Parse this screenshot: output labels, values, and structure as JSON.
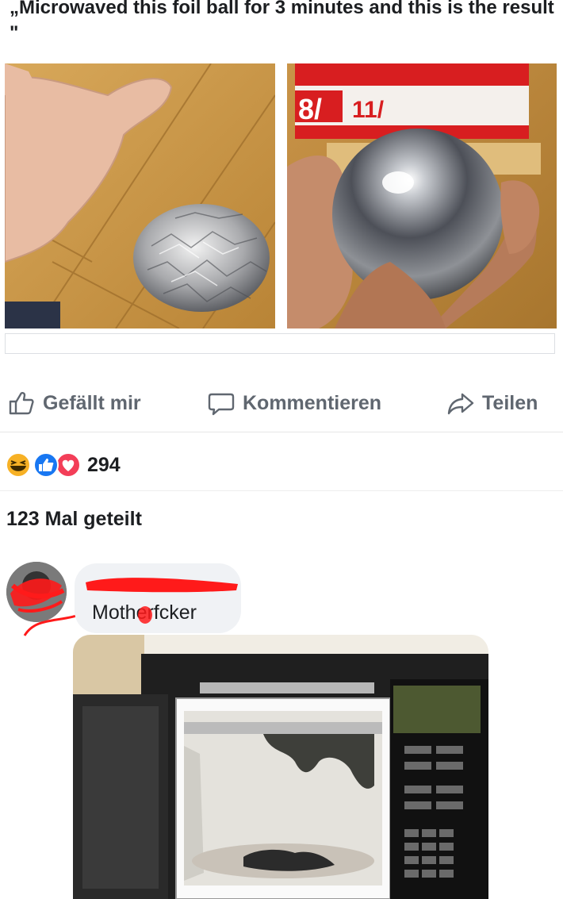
{
  "post": {
    "caption": "„Microwaved this foil ball for 3 minutes and this is the result \""
  },
  "actions": {
    "like_label": "Gefällt mir",
    "comment_label": "Kommentieren",
    "share_label": "Teilen"
  },
  "reactions": {
    "icons": [
      "haha-icon",
      "like-icon",
      "love-icon"
    ],
    "count": "294"
  },
  "shares_text": "123 Mal geteilt",
  "comment": {
    "text": "Motherfcker"
  },
  "colors": {
    "action_text": "#606770",
    "like_blue": "#1877f2",
    "love_red": "#f33e58",
    "haha_yellow": "#f7b125",
    "redaction_red": "#ff1a1a",
    "bubble_bg": "#f0f2f5"
  }
}
